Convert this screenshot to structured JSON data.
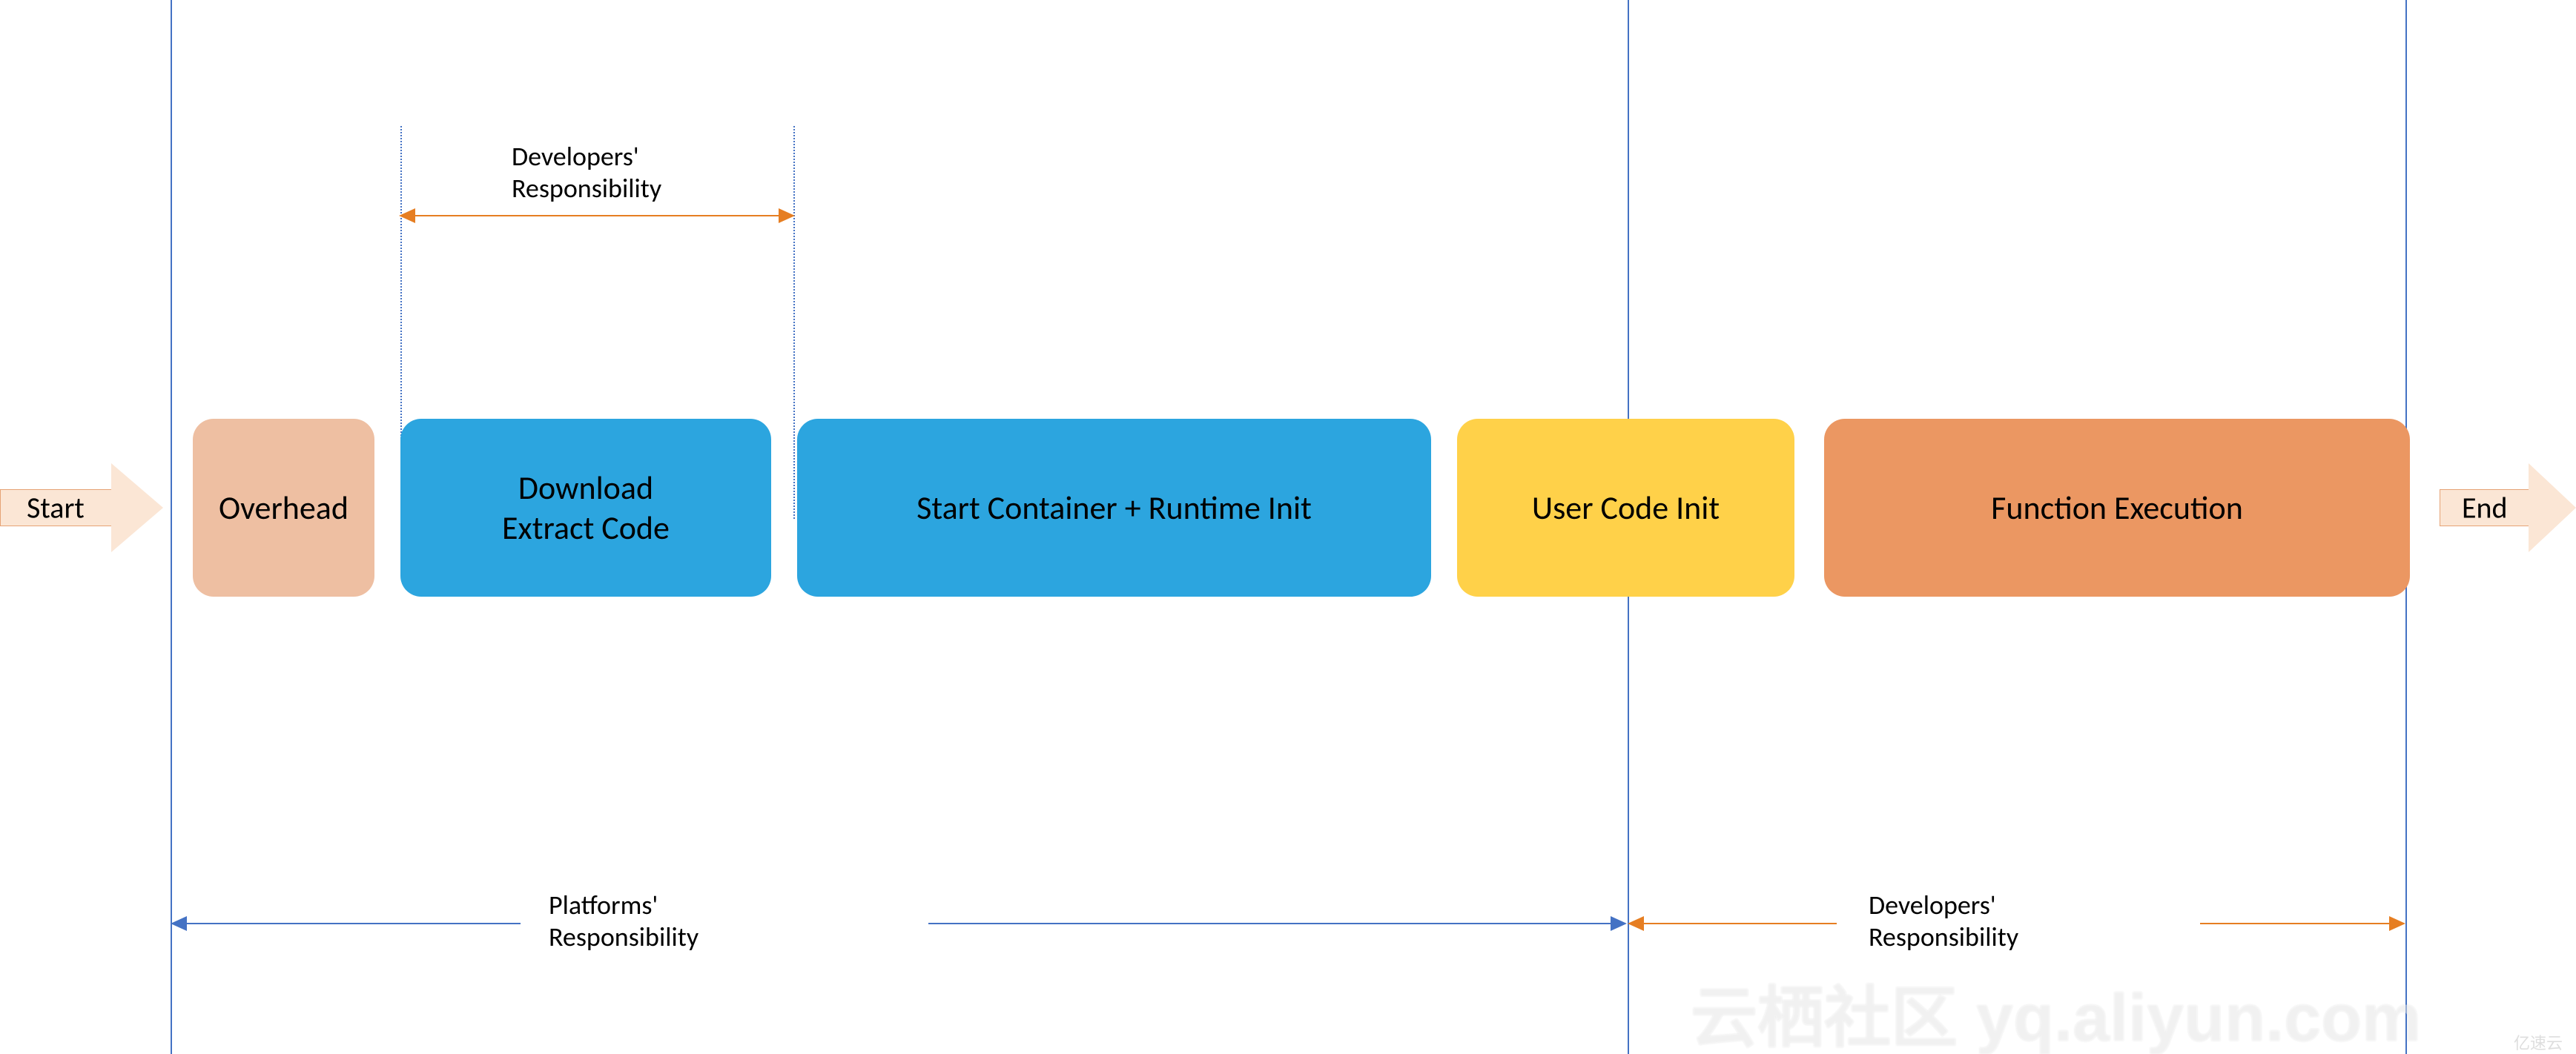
{
  "arrows": {
    "start": "Start",
    "end": "End"
  },
  "stages": {
    "overhead": "Overhead",
    "download_line1": "Download",
    "download_line2": "Extract Code",
    "container": "Start Container + Runtime Init",
    "user_init": "User Code Init",
    "exec": "Function Execution"
  },
  "responsibility": {
    "dev_top_line1": "Developers'",
    "dev_top_line2": "Responsibility",
    "platform_line1": "Platforms'",
    "platform_line2": "Responsibility",
    "dev_bottom_line1": "Developers'",
    "dev_bottom_line2": "Responsibility"
  },
  "watermark": {
    "text": "云栖社区 yq.aliyun.com",
    "tag": "亿速云"
  },
  "colors": {
    "tan": "#eebfa2",
    "blue": "#2ca5df",
    "yellow": "#ffd149",
    "orange": "#eb9762",
    "vline": "#4472c4",
    "range_orange": "#e67e22",
    "range_blue": "#4472c4"
  }
}
